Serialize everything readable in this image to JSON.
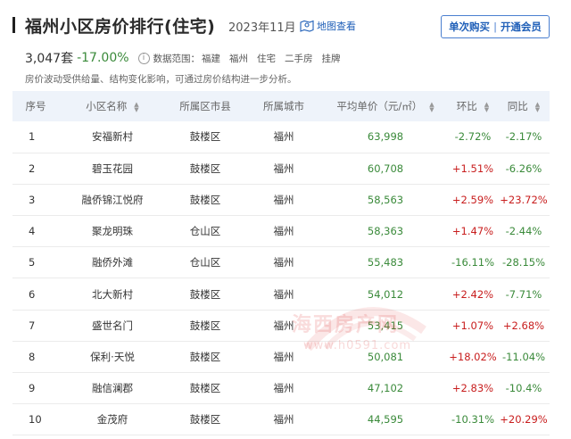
{
  "header": {
    "title": "福州小区房价排行(住宅)",
    "month": "2023年11月",
    "map_link": "地图查看",
    "promo": {
      "buy_once": "单次购买",
      "separator": "|",
      "membership": "开通会员"
    }
  },
  "stats": {
    "count": "3,047套",
    "change": "-17.00%",
    "scope_label": "数据范围：",
    "scope": [
      "福建",
      "福州",
      "住宅",
      "二手房",
      "挂牌"
    ]
  },
  "note": "房价波动受供给量、结构变化影响，可通过房价结构进一步分析。",
  "table": {
    "headers": [
      "序号",
      "小区名称",
      "所属区市县",
      "所属城市",
      "平均单价（元/㎡）",
      "环比",
      "同比"
    ],
    "rows": [
      {
        "idx": "1",
        "name": "安福新村",
        "district": "鼓楼区",
        "city": "福州",
        "price": "63,998",
        "mom": "-2.72%",
        "yoy": "-2.17%"
      },
      {
        "idx": "2",
        "name": "碧玉花园",
        "district": "鼓楼区",
        "city": "福州",
        "price": "60,708",
        "mom": "+1.51%",
        "yoy": "-6.26%"
      },
      {
        "idx": "3",
        "name": "融侨锦江悦府",
        "district": "鼓楼区",
        "city": "福州",
        "price": "58,563",
        "mom": "+2.59%",
        "yoy": "+23.72%"
      },
      {
        "idx": "4",
        "name": "聚龙明珠",
        "district": "仓山区",
        "city": "福州",
        "price": "58,363",
        "mom": "+1.47%",
        "yoy": "-2.44%"
      },
      {
        "idx": "5",
        "name": "融侨外滩",
        "district": "仓山区",
        "city": "福州",
        "price": "55,483",
        "mom": "-16.11%",
        "yoy": "-28.15%"
      },
      {
        "idx": "6",
        "name": "北大新村",
        "district": "鼓楼区",
        "city": "福州",
        "price": "54,012",
        "mom": "+2.42%",
        "yoy": "-7.71%"
      },
      {
        "idx": "7",
        "name": "盛世名门",
        "district": "鼓楼区",
        "city": "福州",
        "price": "53,415",
        "mom": "+1.07%",
        "yoy": "+2.68%"
      },
      {
        "idx": "8",
        "name": "保利·天悦",
        "district": "鼓楼区",
        "city": "福州",
        "price": "50,081",
        "mom": "+18.02%",
        "yoy": "-11.04%"
      },
      {
        "idx": "9",
        "name": "融信澜郡",
        "district": "鼓楼区",
        "city": "福州",
        "price": "47,102",
        "mom": "+2.83%",
        "yoy": "-10.4%"
      },
      {
        "idx": "10",
        "name": "金茂府",
        "district": "鼓楼区",
        "city": "福州",
        "price": "44,595",
        "mom": "-10.31%",
        "yoy": "+20.29%"
      }
    ]
  },
  "watermark": {
    "text": "海西房产网",
    "url": "www.h0591.com"
  },
  "colors": {
    "accent": "#1f5fb8",
    "up": "#c81e1e",
    "down": "#3a8a3a",
    "header_bg": "#eef3fa"
  },
  "icons": {
    "map": "map-pin-icon",
    "info": "info-icon",
    "sort": "sort-icon"
  }
}
